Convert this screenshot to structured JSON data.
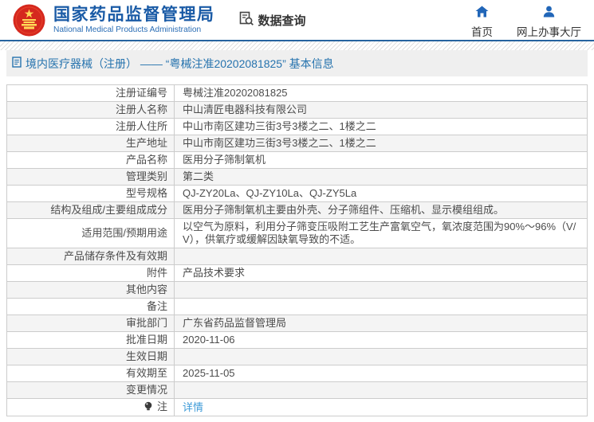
{
  "header": {
    "org_name": "国家药品监督管理局",
    "org_name_en": "National Medical Products Administration",
    "data_query_label": "数据查询",
    "nav_home_label": "首页",
    "nav_hall_label": "网上办事大厅"
  },
  "page_title": "境内医疗器械（注册） —— “粤械注准20202081825” 基本信息",
  "table": {
    "rows": [
      {
        "label": "注册证编号",
        "value": "粤械注准20202081825"
      },
      {
        "label": "注册人名称",
        "value": "中山清匠电器科技有限公司"
      },
      {
        "label": "注册人住所",
        "value": "中山市南区建功三街3号3楼之二、1楼之二"
      },
      {
        "label": "生产地址",
        "value": "中山市南区建功三街3号3楼之二、1楼之二"
      },
      {
        "label": "产品名称",
        "value": "医用分子筛制氧机"
      },
      {
        "label": "管理类别",
        "value": "第二类"
      },
      {
        "label": "型号规格",
        "value": "QJ-ZY20La、QJ-ZY10La、QJ-ZY5La"
      },
      {
        "label": "结构及组成/主要组成成分",
        "value": "医用分子筛制氧机主要由外壳、分子筛组件、压缩机、显示模组组成。"
      },
      {
        "label": "适用范围/预期用途",
        "value": "以空气为原料，利用分子筛变压吸附工艺生产富氧空气，氧浓度范围为90%～96%（V/V），供氧疗或缓解因缺氧导致的不适。"
      },
      {
        "label": "产品储存条件及有效期",
        "value": ""
      },
      {
        "label": "附件",
        "value": "产品技术要求"
      },
      {
        "label": "其他内容",
        "value": ""
      },
      {
        "label": "备注",
        "value": ""
      },
      {
        "label": "审批部门",
        "value": "广东省药品监督管理局"
      },
      {
        "label": "批准日期",
        "value": "2020-11-06"
      },
      {
        "label": "生效日期",
        "value": ""
      },
      {
        "label": "有效期至",
        "value": "2025-11-05"
      },
      {
        "label": "变更情况",
        "value": ""
      },
      {
        "label": "注",
        "value": "详情",
        "is_link": true,
        "icon": "lamp-icon"
      }
    ]
  },
  "colors": {
    "accent_blue": "#1a5ba6",
    "title_blue": "#2673ae",
    "link_blue": "#3e9bd8",
    "separator_blue": "#26639f",
    "row_alt_bg": "#f4f4f4",
    "border_gray": "#cccccc",
    "emblem_red": "#d5281e",
    "emblem_gold": "#ffd957"
  }
}
